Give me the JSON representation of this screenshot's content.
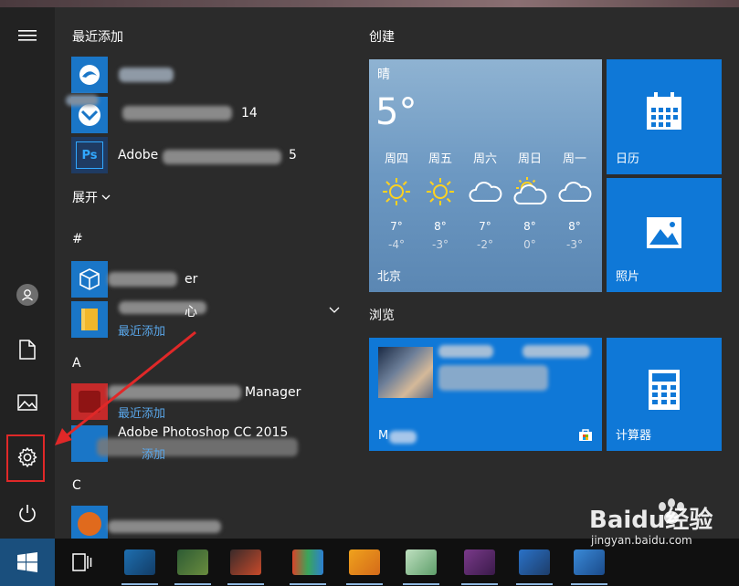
{
  "sidebar": {
    "menu_icon": "hamburger-icon",
    "items": [
      {
        "icon": "user-icon"
      },
      {
        "icon": "document-icon"
      },
      {
        "icon": "pictures-icon"
      },
      {
        "icon": "settings-gear-icon"
      },
      {
        "icon": "power-icon"
      }
    ]
  },
  "applist": {
    "recent_header": "最近添加",
    "recent": [
      {
        "name": "",
        "icon_color": "#1a76c7"
      },
      {
        "name": "14",
        "icon_color": "#1a76c7"
      },
      {
        "name": "Adobe",
        "name_suffix": "5",
        "icon_color": "#1a76c7"
      }
    ],
    "expand_label": "展开",
    "sections": [
      {
        "letter": "#",
        "apps": [
          {
            "name": "er",
            "sub": ""
          },
          {
            "name": "心",
            "sub": "最近添加"
          }
        ]
      },
      {
        "letter": "A",
        "apps": [
          {
            "name": "Manager",
            "sub": "最近添加"
          },
          {
            "name": "Adobe Photoshop CC 2015",
            "sub": "添加"
          }
        ]
      },
      {
        "letter": "C",
        "apps": []
      }
    ]
  },
  "tiles": {
    "group_create": "创建",
    "group_browse": "浏览",
    "weather": {
      "condition": "晴",
      "current_temp": "5°",
      "city": "北京",
      "forecast": [
        {
          "day": "周四",
          "hi": "7°",
          "lo": "-4°",
          "icon": "sun-icon"
        },
        {
          "day": "周五",
          "hi": "8°",
          "lo": "-3°",
          "icon": "sun-icon"
        },
        {
          "day": "周六",
          "hi": "7°",
          "lo": "-2°",
          "icon": "cloud-icon"
        },
        {
          "day": "周日",
          "hi": "8°",
          "lo": "0°",
          "icon": "partly-cloudy-icon"
        },
        {
          "day": "周一",
          "hi": "8°",
          "lo": "-3°",
          "icon": "cloud-icon"
        }
      ]
    },
    "calendar_label": "日历",
    "photos_label": "照片",
    "store_label": "M",
    "calculator_label": "计算器"
  },
  "taskbar": {
    "start_icon": "windows-logo-icon",
    "taskview_icon": "task-view-icon"
  },
  "watermark": {
    "brand": "Baidu经验",
    "url": "jingyan.baidu.com"
  },
  "colors": {
    "tile_blue": "#0f78d7",
    "accent_link": "#5aa7ea",
    "highlight_red": "#e02828"
  }
}
